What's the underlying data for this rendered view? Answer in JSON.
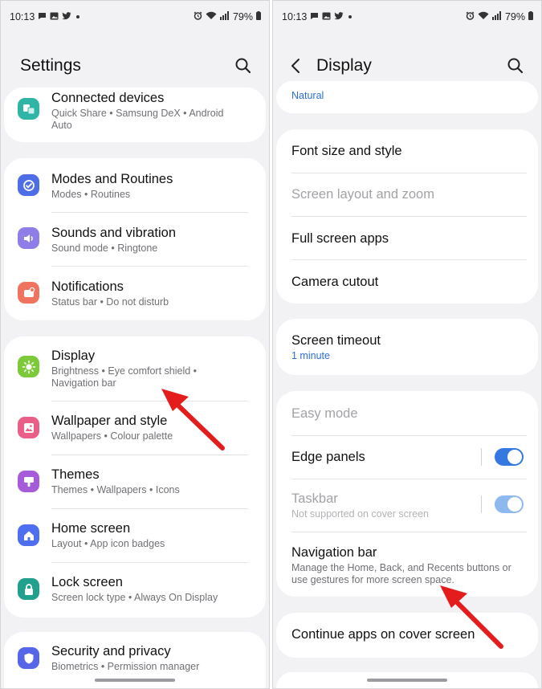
{
  "left": {
    "status": {
      "time": "10:13",
      "battery": "79%"
    },
    "title": "Settings",
    "groups": [
      {
        "items": [
          {
            "title": "Connected devices",
            "subtitle": "Quick Share  •  Samsung DeX  •  Android Auto",
            "icon": "connected-devices-icon",
            "color": "#2fb5a6"
          }
        ]
      },
      {
        "items": [
          {
            "title": "Modes and Routines",
            "subtitle": "Modes  •  Routines",
            "icon": "modes-routines-icon",
            "color": "#4d6ee6"
          },
          {
            "title": "Sounds and vibration",
            "subtitle": "Sound mode  •  Ringtone",
            "icon": "sound-icon",
            "color": "#8f7ee8"
          },
          {
            "title": "Notifications",
            "subtitle": "Status bar  •  Do not disturb",
            "icon": "notifications-icon",
            "color": "#ef735f"
          }
        ]
      },
      {
        "items": [
          {
            "title": "Display",
            "subtitle": "Brightness  •  Eye comfort shield  •  Navigation bar",
            "icon": "display-icon",
            "color": "#7cc93a"
          },
          {
            "title": "Wallpaper and style",
            "subtitle": "Wallpapers  •  Colour palette",
            "icon": "wallpaper-icon",
            "color": "#ea5f87"
          },
          {
            "title": "Themes",
            "subtitle": "Themes  •  Wallpapers  •  Icons",
            "icon": "themes-icon",
            "color": "#a65bd8"
          },
          {
            "title": "Home screen",
            "subtitle": "Layout  •  App icon badges",
            "icon": "home-icon",
            "color": "#4e6ff0"
          },
          {
            "title": "Lock screen",
            "subtitle": "Screen lock type  •  Always On Display",
            "icon": "lock-icon",
            "color": "#22a08e"
          }
        ]
      },
      {
        "items": [
          {
            "title": "Security and privacy",
            "subtitle": "Biometrics  •  Permission manager",
            "icon": "shield-icon",
            "color": "#5567e8"
          }
        ]
      }
    ]
  },
  "right": {
    "status": {
      "time": "10:13",
      "battery": "79%"
    },
    "title": "Display",
    "top_value": "Natural",
    "items": [
      {
        "title": "Font size and style"
      },
      {
        "title": "Screen layout and zoom"
      },
      {
        "title": "Full screen apps"
      },
      {
        "title": "Camera cutout"
      },
      {
        "title": "Screen timeout",
        "subtitle": "1 minute"
      },
      {
        "title": "Easy mode"
      },
      {
        "title": "Edge panels",
        "toggle": true
      },
      {
        "title": "Taskbar",
        "subtitle": "Not supported on cover screen",
        "toggle": true
      },
      {
        "title": "Navigation bar",
        "subtitle": "Manage the Home, Back, and Recents buttons or use gestures for more screen space."
      },
      {
        "title": "Continue apps on cover screen"
      }
    ]
  },
  "colors": {
    "accent": "#3478e0",
    "arrow": "#e41c1c",
    "background": "#f2f2f4"
  }
}
